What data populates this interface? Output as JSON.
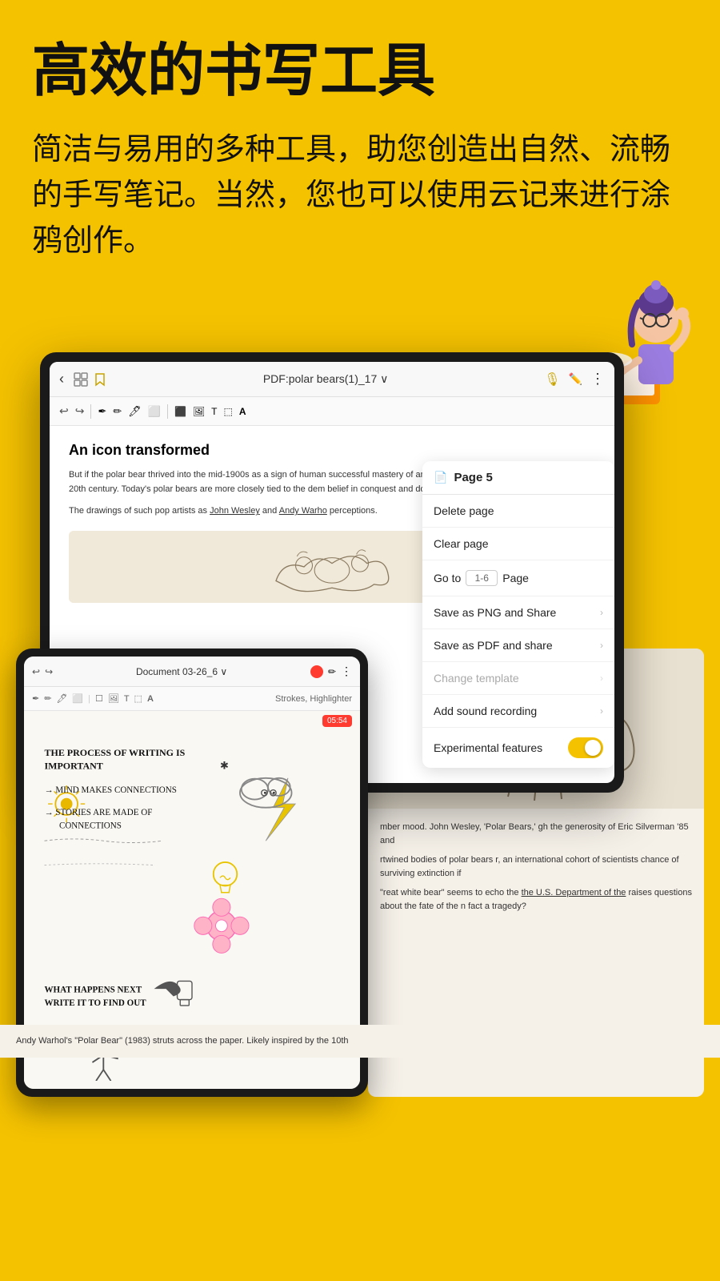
{
  "hero": {
    "title": "高效的书写工具",
    "subtitle": "简洁与易用的多种工具，助您创造出自然、流畅的手写笔记。当然，您也可以使用云记来进行涂鸦创作。"
  },
  "toolbar": {
    "document_title": "PDF:polar bears(1)_17 ∨",
    "back_arrow": "‹",
    "mic_icon": "🎤",
    "pencil_icon": "✏",
    "more_icon": "⋮"
  },
  "context_menu": {
    "page_title": "Page 5",
    "items": [
      {
        "label": "Delete page",
        "has_chevron": false,
        "disabled": false
      },
      {
        "label": "Clear page",
        "has_chevron": false,
        "disabled": false
      },
      {
        "label": "Go to",
        "is_goto": true,
        "goto_placeholder": "1-6",
        "goto_suffix": "Page",
        "disabled": false
      },
      {
        "label": "Save as PNG and Share",
        "has_chevron": true,
        "disabled": false
      },
      {
        "label": "Save as PDF and share",
        "has_chevron": true,
        "disabled": false
      },
      {
        "label": "Change template",
        "has_chevron": true,
        "disabled": true
      },
      {
        "label": "Add sound recording",
        "has_chevron": true,
        "disabled": false
      },
      {
        "label": "Experimental features",
        "has_toggle": true,
        "disabled": false
      }
    ]
  },
  "doc_content": {
    "title": "An icon transformed",
    "body1": "But if the polar bear thrived into the mid-1900s as a sign of human successful mastery of antagonistic forces, this symbolic associatio 20th century. Today's polar bears are more closely tied to the dem belief in conquest and domination.",
    "body2": "The drawings of such pop artists as John Wesley and Andy Warho perceptions.",
    "link1": "John Wesley",
    "link2": "Andy Warhol"
  },
  "small_device": {
    "title": "Document 03-26_6 ∨",
    "timer": "05:54",
    "strokes_label": "Strokes, Highlighter",
    "handwriting": [
      "THE PROCESS OF WRITING IS",
      "IMPORTANT",
      "→ MIND MAKES CONNECTIONS",
      "→ STORIES ARE MADE OF",
      "     CONNECTIONS",
      "WHAT HAPPENS NEXT",
      "WRITE IT TO FIND OUT"
    ]
  },
  "pdf_section": {
    "text1": "mber mood. John Wesley, 'Polar Bears,' gh the generosity of Eric Silverman '85 and",
    "text2": "rtwined bodies of polar bears r, an international cohort of scientists chance of surviving extinction if",
    "text3": "reat white bear\" seems to echo the he U.S. Department of the raises questions about the fate of the n fact a tragedy?",
    "footer": "Andy Warhol's \"Polar Bear\" (1983) struts across the paper. Likely inspired by the 10th",
    "dept_text": "Department of the"
  },
  "colors": {
    "background": "#F5C200",
    "accent": "#F5C200",
    "device_border": "#1a1a1a",
    "menu_bg": "#ffffff",
    "toggle_bg": "#F5C200",
    "record_red": "#ff3b30"
  }
}
